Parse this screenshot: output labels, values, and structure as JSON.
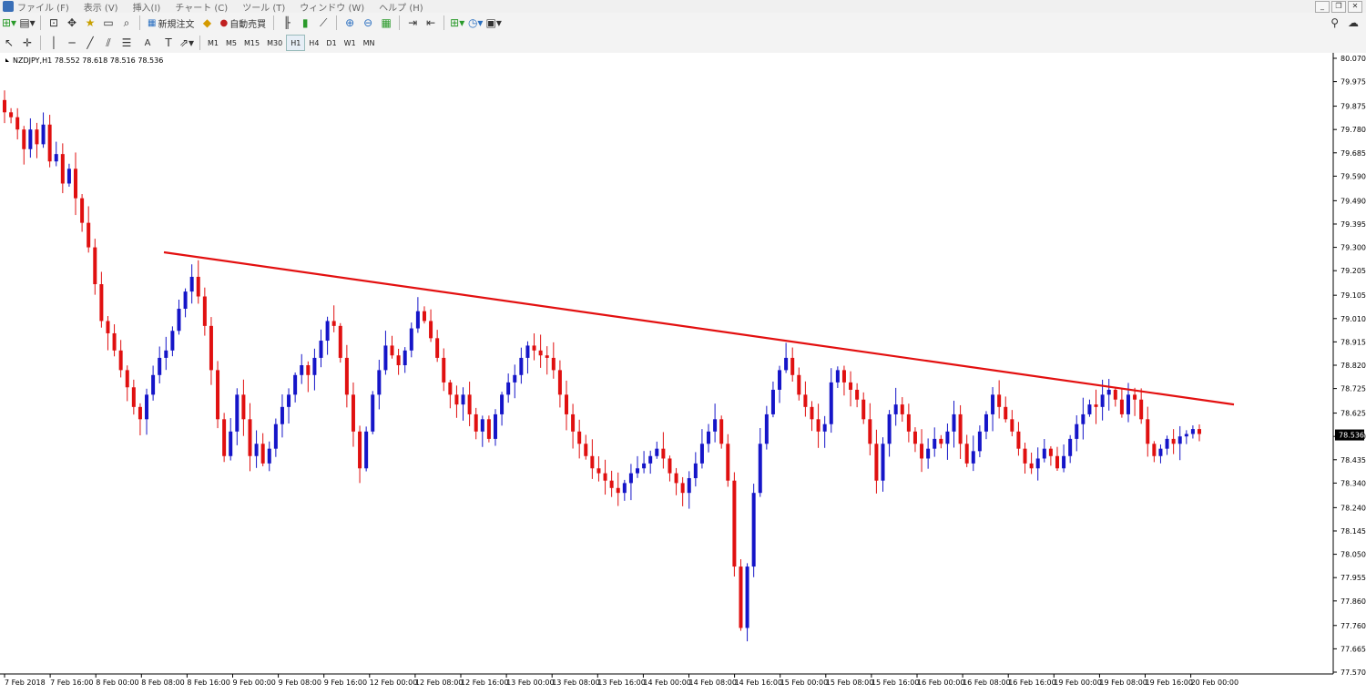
{
  "menu": [
    "ファイル (F)",
    "表示 (V)",
    "挿入(I)",
    "チャート (C)",
    "ツール (T)",
    "ウィンドウ (W)",
    "ヘルプ (H)"
  ],
  "toolbar": {
    "new_order_label": "新規注文",
    "auto_trade_label": "自動売買",
    "timeframes": [
      "M1",
      "M5",
      "M15",
      "M30",
      "H1",
      "H4",
      "D1",
      "W1",
      "MN"
    ],
    "active_timeframe": "H1"
  },
  "chart_info": "NZDJPY,H1  78.552 78.618 78.516 78.536",
  "colors": {
    "bull": "#1515c8",
    "bear": "#e01010",
    "trendline": "#e31010"
  },
  "chart_data": {
    "type": "candlestick",
    "symbol": "NZDJPY",
    "timeframe": "H1",
    "ohlc_last": {
      "open": 78.552,
      "high": 78.618,
      "low": 78.516,
      "close": 78.536
    },
    "current_price": "78.536",
    "ylim": [
      77.57,
      80.07
    ],
    "y_ticks": [
      "80.070",
      "79.975",
      "79.875",
      "79.780",
      "79.685",
      "79.590",
      "79.490",
      "79.395",
      "79.300",
      "79.205",
      "79.105",
      "79.010",
      "78.915",
      "78.820",
      "78.725",
      "78.625",
      "78.530",
      "78.435",
      "78.340",
      "78.240",
      "78.145",
      "78.050",
      "77.955",
      "77.860",
      "77.760",
      "77.665",
      "77.570"
    ],
    "x_ticks": [
      "7 Feb 2018",
      "7 Feb 16:00",
      "8 Feb 00:00",
      "8 Feb 08:00",
      "8 Feb 16:00",
      "9 Feb 00:00",
      "9 Feb 08:00",
      "9 Feb 16:00",
      "12 Feb 00:00",
      "12 Feb 08:00",
      "12 Feb 16:00",
      "13 Feb 00:00",
      "13 Feb 08:00",
      "13 Feb 16:00",
      "14 Feb 00:00",
      "14 Feb 08:00",
      "14 Feb 16:00",
      "15 Feb 00:00",
      "15 Feb 08:00",
      "15 Feb 16:00",
      "16 Feb 00:00",
      "16 Feb 08:00",
      "16 Feb 16:00",
      "19 Feb 00:00",
      "19 Feb 08:00",
      "19 Feb 16:00",
      "20 Feb 00:00"
    ],
    "close_path": [
      79.85,
      79.83,
      79.78,
      79.7,
      79.78,
      79.72,
      79.8,
      79.65,
      79.68,
      79.56,
      79.62,
      79.5,
      79.4,
      79.3,
      79.15,
      79.0,
      78.95,
      78.88,
      78.8,
      78.73,
      78.65,
      78.6,
      78.7,
      78.78,
      78.85,
      78.88,
      78.96,
      79.05,
      79.12,
      79.18,
      79.1,
      78.98,
      78.8,
      78.6,
      78.45,
      78.55,
      78.7,
      78.6,
      78.45,
      78.5,
      78.42,
      78.48,
      78.58,
      78.65,
      78.7,
      78.78,
      78.82,
      78.78,
      78.85,
      78.92,
      79.0,
      78.98,
      78.85,
      78.7,
      78.55,
      78.4,
      78.55,
      78.7,
      78.8,
      78.9,
      78.86,
      78.82,
      78.88,
      78.97,
      79.04,
      79.0,
      78.93,
      78.85,
      78.75,
      78.7,
      78.66,
      78.7,
      78.62,
      78.55,
      78.6,
      78.52,
      78.62,
      78.7,
      78.75,
      78.78,
      78.85,
      78.9,
      78.88,
      78.86,
      78.85,
      78.8,
      78.7,
      78.62,
      78.55,
      78.5,
      78.45,
      78.4,
      78.38,
      78.35,
      78.32,
      78.3,
      78.34,
      78.38,
      78.4,
      78.42,
      78.45,
      78.48,
      78.44,
      78.38,
      78.34,
      78.3,
      78.36,
      78.42,
      78.5,
      78.55,
      78.6,
      78.5,
      78.35,
      78.0,
      77.75,
      78.0,
      78.3,
      78.5,
      78.62,
      78.72,
      78.8,
      78.85,
      78.78,
      78.7,
      78.65,
      78.6,
      78.55,
      78.58,
      78.75,
      78.8,
      78.75,
      78.72,
      78.68,
      78.6,
      78.5,
      78.35,
      78.5,
      78.62,
      78.66,
      78.62,
      78.55,
      78.5,
      78.44,
      78.48,
      78.52,
      78.5,
      78.55,
      78.62,
      78.5,
      78.42,
      78.47,
      78.55,
      78.62,
      78.7,
      78.65,
      78.6,
      78.55,
      78.48,
      78.42,
      78.4,
      78.44,
      78.48,
      78.45,
      78.4,
      78.45,
      78.52,
      78.58,
      78.62,
      78.66,
      78.65,
      78.7,
      78.72,
      78.68,
      78.62,
      78.7,
      78.68,
      78.6,
      78.5,
      78.45,
      78.48,
      78.52,
      78.5,
      78.53,
      78.54,
      78.56,
      78.54
    ]
  }
}
